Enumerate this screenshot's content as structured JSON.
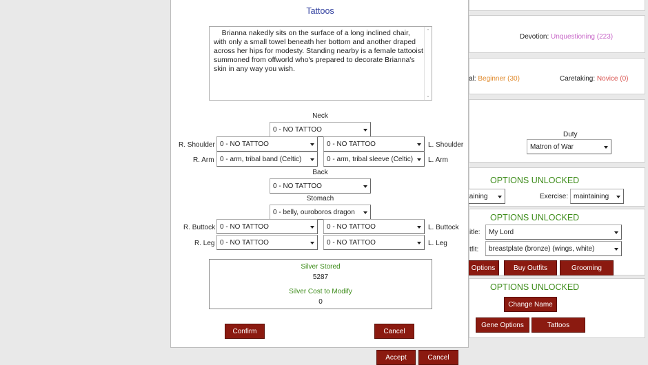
{
  "modal": {
    "title": "Tattoos",
    "description": "    Brianna nakedly sits on the surface of a long inclined chair, with only a small towel beneath her bottom and another draped across her hips for modesty. Standing nearby is a female tattooist summoned from offworld who's prepared to decorate Brianna's skin in any way you wish.",
    "labels": {
      "neck": "Neck",
      "r_shoulder": "R. Shoulder",
      "l_shoulder": "L. Shoulder",
      "r_arm": "R. Arm",
      "l_arm": "L. Arm",
      "back": "Back",
      "stomach": "Stomach",
      "r_buttock": "R. Buttock",
      "l_buttock": "L. Buttock",
      "r_leg": "R. Leg",
      "l_leg": "L. Leg"
    },
    "selects": {
      "neck": "0 - NO TATTOO",
      "r_shoulder": "0 - NO TATTOO",
      "l_shoulder": "0 - NO TATTOO",
      "r_arm": "0 - arm, tribal band (Celtic)",
      "l_arm": "0 - arm, tribal sleeve (Celtic)",
      "back": "0 - NO TATTOO",
      "stomach": "0 - belly, ouroboros dragon",
      "r_buttock": "0 - NO TATTOO",
      "l_buttock": "0 - NO TATTOO",
      "r_leg": "0 - NO TATTOO",
      "l_leg": "0 - NO TATTOO"
    },
    "silver": {
      "stored_label": "Silver Stored",
      "stored_value": "5287",
      "cost_label": "Silver Cost to Modify",
      "cost_value": "0"
    },
    "confirm_label": "Confirm",
    "cancel_label": "Cancel"
  },
  "background": {
    "devotion_label": "Devotion:",
    "devotion_value": "Unquestioning (223)",
    "skill_partial_label": "al:",
    "skill_value": "Beginner (30)",
    "caretaking_label": "Caretaking:",
    "caretaking_value": "Novice (0)",
    "duty_label": "Duty",
    "duty_value": "Matron of War",
    "options_unlocked_1": "OPTIONS UNLOCKED",
    "diet_partial_value": "taining",
    "exercise_label": "Exercise:",
    "exercise_value": "maintaining",
    "options_unlocked_2": "OPTIONS UNLOCKED",
    "title_partial_label": "itle:",
    "title_value": "My Lord",
    "outfit_partial_label": "tfit:",
    "outfit_value": "breastplate (bronze) (wings, white)",
    "options_button": "Options",
    "buy_outfits_button": "Buy Outfits",
    "grooming_button": "Grooming",
    "options_unlocked_3": "OPTIONS UNLOCKED",
    "change_name_button": "Change Name",
    "gene_options_button": "Gene Options",
    "tattoos_button": "Tattoos",
    "accept_button": "Accept",
    "cancel_button": "Cancel"
  },
  "colors": {
    "button_bg": "#8b1a10",
    "green_text": "#3d8c1a",
    "title_blue": "#2f3e9e",
    "devotion_pink": "#c765c7",
    "skill_orange": "#e08a2c",
    "caretaking_red": "#d9534f"
  }
}
